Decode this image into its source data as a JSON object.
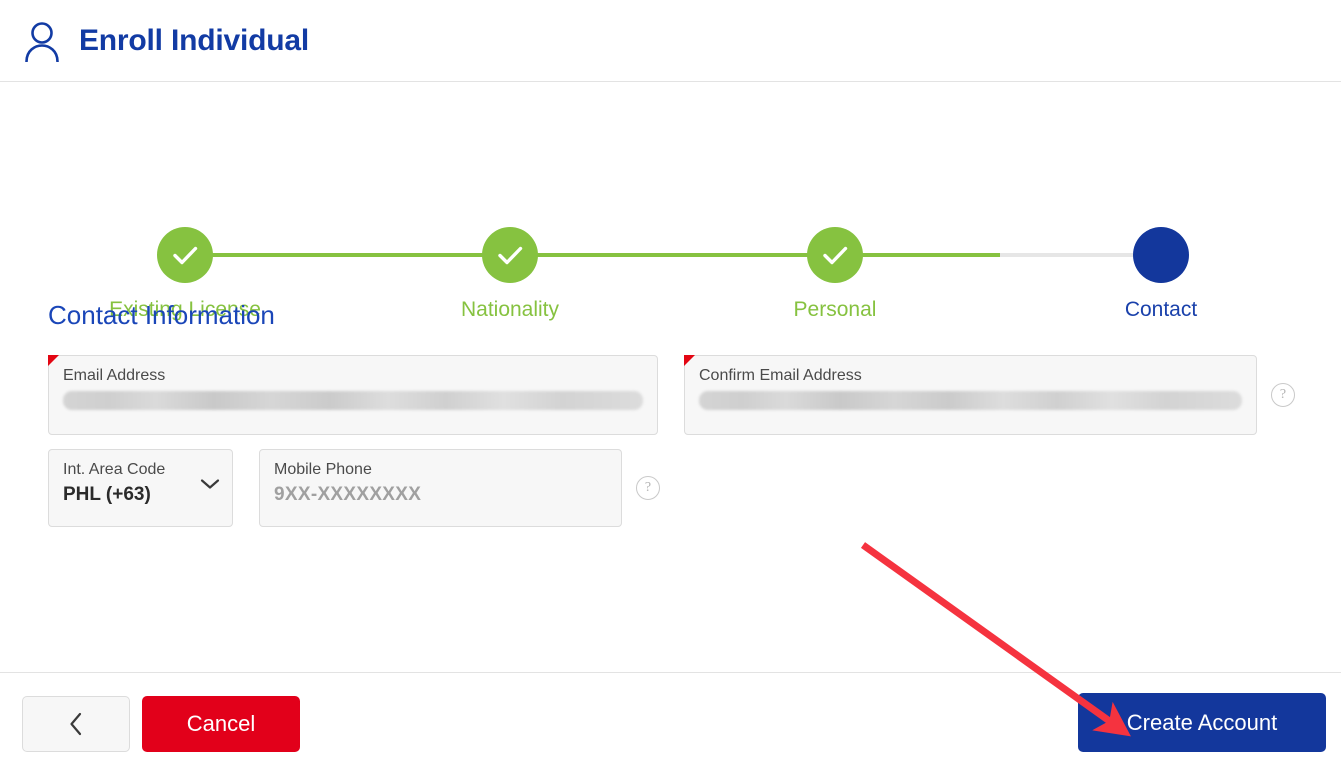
{
  "header": {
    "title": "Enroll Individual",
    "icon": "person-icon",
    "title_color": "#123ba4"
  },
  "stepper": {
    "track_color": "#e6e6e6",
    "done_color": "#86c240",
    "current_color": "#13379c",
    "steps": [
      {
        "label": "Existing License",
        "state": "done"
      },
      {
        "label": "Nationality",
        "state": "done"
      },
      {
        "label": "Personal",
        "state": "done"
      },
      {
        "label": "Contact",
        "state": "current"
      }
    ]
  },
  "form": {
    "section_title": "Contact Information",
    "fields": {
      "email": {
        "label": "Email Address",
        "value": "",
        "redacted": true,
        "required": true
      },
      "confirm_email": {
        "label": "Confirm Email Address",
        "value": "",
        "redacted": true,
        "required": true,
        "help_icon": "question-mark-icon"
      },
      "area_code": {
        "label": "Int. Area Code",
        "value": "PHL (+63)",
        "required": false,
        "icon": "chevron-down-icon"
      },
      "mobile_phone": {
        "label": "Mobile Phone",
        "placeholder": "9XX-XXXXXXXX",
        "value": "",
        "required": false,
        "help_icon": "question-mark-icon"
      }
    }
  },
  "footer": {
    "back_label": "",
    "back_icon": "chevron-left-icon",
    "cancel_label": "Cancel",
    "create_label": "Create Account",
    "cancel_color": "#e2001a",
    "create_color": "#13379c"
  },
  "annotation": {
    "type": "arrow",
    "color": "#f5333f",
    "points_to": "Create Account"
  }
}
